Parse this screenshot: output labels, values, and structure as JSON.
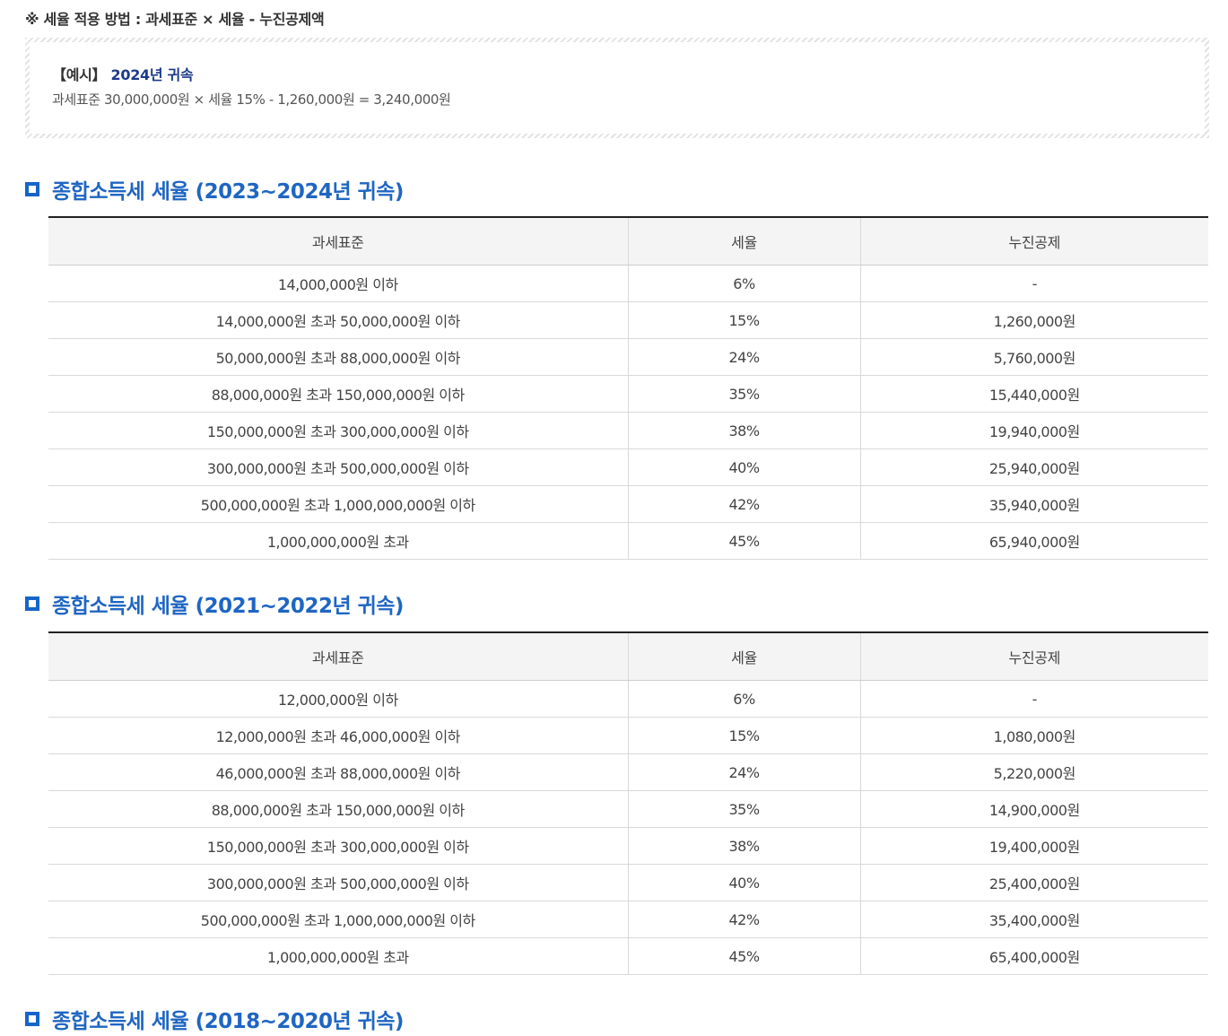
{
  "note": "※ 세율 적용 방법 : 과세표준 × 세율 - 누진공제액",
  "example": {
    "bracket_label": "【예시】",
    "year_label": "2024년 귀속",
    "formula": "과세표준 30,000,000원 × 세율 15% - 1,260,000원 = 3,240,000원"
  },
  "sections": [
    {
      "title": "종합소득세 세율 (2023~2024년 귀속)",
      "headers": [
        "과세표준",
        "세율",
        "누진공제"
      ],
      "rows": [
        [
          "14,000,000원 이하",
          "6%",
          "-"
        ],
        [
          "14,000,000원 초과 50,000,000원 이하",
          "15%",
          "1,260,000원"
        ],
        [
          "50,000,000원 초과 88,000,000원 이하",
          "24%",
          "5,760,000원"
        ],
        [
          "88,000,000원 초과 150,000,000원 이하",
          "35%",
          "15,440,000원"
        ],
        [
          "150,000,000원 초과 300,000,000원 이하",
          "38%",
          "19,940,000원"
        ],
        [
          "300,000,000원 초과 500,000,000원 이하",
          "40%",
          "25,940,000원"
        ],
        [
          "500,000,000원 초과 1,000,000,000원 이하",
          "42%",
          "35,940,000원"
        ],
        [
          "1,000,000,000원 초과",
          "45%",
          "65,940,000원"
        ]
      ]
    },
    {
      "title": "종합소득세 세율 (2021~2022년 귀속)",
      "headers": [
        "과세표준",
        "세율",
        "누진공제"
      ],
      "rows": [
        [
          "12,000,000원 이하",
          "6%",
          "-"
        ],
        [
          "12,000,000원 초과 46,000,000원 이하",
          "15%",
          "1,080,000원"
        ],
        [
          "46,000,000원 초과 88,000,000원 이하",
          "24%",
          "5,220,000원"
        ],
        [
          "88,000,000원 초과 150,000,000원 이하",
          "35%",
          "14,900,000원"
        ],
        [
          "150,000,000원 초과 300,000,000원 이하",
          "38%",
          "19,400,000원"
        ],
        [
          "300,000,000원 초과 500,000,000원 이하",
          "40%",
          "25,400,000원"
        ],
        [
          "500,000,000원 초과 1,000,000,000원 이하",
          "42%",
          "35,400,000원"
        ],
        [
          "1,000,000,000원 초과",
          "45%",
          "65,400,000원"
        ]
      ]
    },
    {
      "title": "종합소득세 세율 (2018~2020년 귀속)"
    }
  ],
  "colors": {
    "section_title": "#1f66c2",
    "icon": "#1565c9",
    "example_year": "#1c3a8a"
  }
}
